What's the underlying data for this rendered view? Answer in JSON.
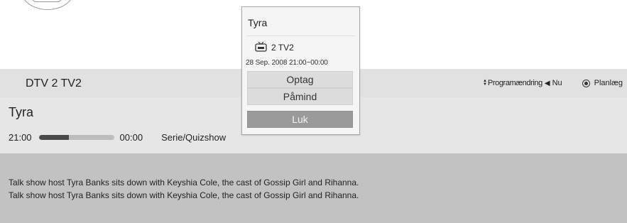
{
  "header": {
    "channel": "DTV 2  TV2",
    "nav_hints": {
      "program_change": "Programændring",
      "now": "Nu",
      "schedule": "Planlæg"
    }
  },
  "program": {
    "title": "Tyra",
    "start_time": "21:00",
    "end_time": "00:00",
    "progress_fraction": 0.4,
    "genre": "Serie/Quizshow",
    "description_lines": [
      "Talk show host Tyra Banks sits down with Keyshia Cole, the cast of Gossip Girl and Rihanna.",
      "Talk show host Tyra Banks sits down with Keyshia Cole, the cast of Gossip Girl and Rihanna."
    ]
  },
  "popup": {
    "title": "Tyra",
    "channel": "2 TV2",
    "datetime": "28 Sep. 2008 21:00~00:00",
    "record_label": "Optag",
    "remind_label": "Påmind",
    "close_label": "Luk"
  },
  "colors": {
    "info_bar": "#e6e6e6",
    "description_area": "#c2c2c2",
    "close_button": "#9a9a9a"
  }
}
